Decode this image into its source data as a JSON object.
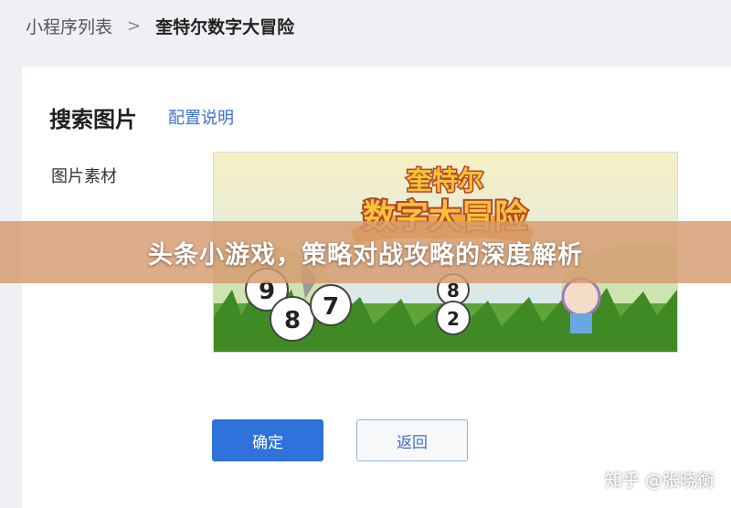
{
  "breadcrumb": {
    "parent": "小程序列表",
    "separator": ">",
    "current": "奎特尔数字大冒险"
  },
  "page": {
    "title": "搜索图片",
    "config_link": "配置说明"
  },
  "form": {
    "image_label": "图片素材",
    "game_logo_line1": "奎特尔",
    "game_logo_line2": "数字大冒险"
  },
  "buttons": {
    "confirm": "确定",
    "back": "返回"
  },
  "banner": {
    "text": "头条小游戏，策略对战攻略的深度解析"
  },
  "watermark": {
    "text": "知乎 @张晓衡"
  },
  "colors": {
    "primary": "#2f72dc",
    "link": "#3b6fd6",
    "banner": "#d69a6e"
  }
}
